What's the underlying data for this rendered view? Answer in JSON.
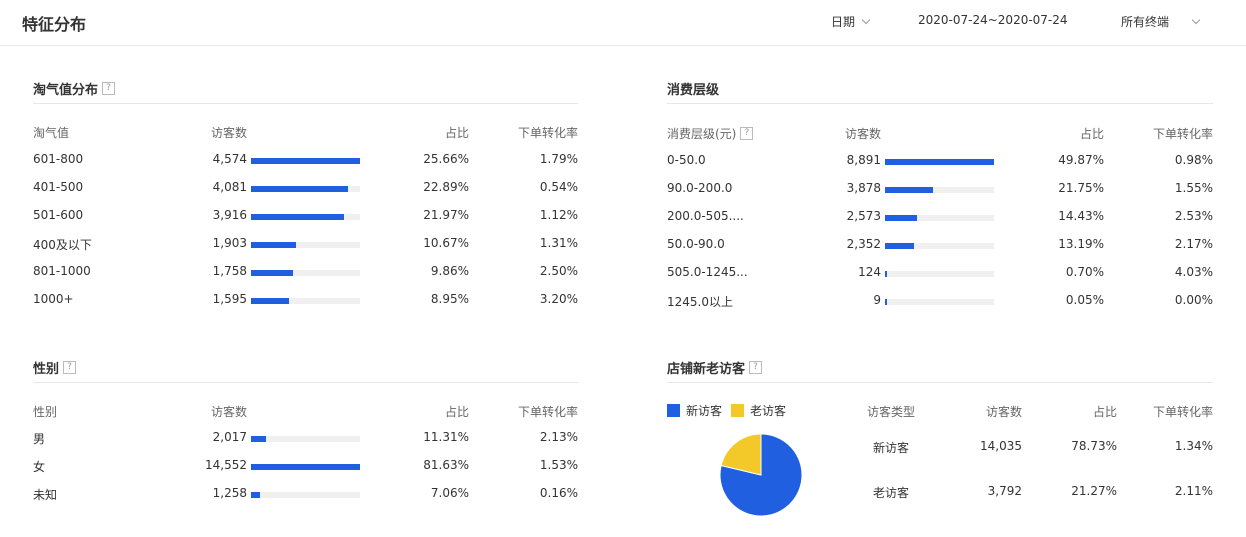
{
  "header": {
    "title": "特征分布",
    "date_label": "日期",
    "date_range": "2020-07-24~2020-07-24",
    "device": "所有终端"
  },
  "taoqi": {
    "title": "淘气值分布",
    "help": "?",
    "columns": [
      "淘气值",
      "访客数",
      "占比",
      "下单转化率"
    ],
    "rows": [
      {
        "label": "601-800",
        "visitors": "4,574",
        "share": "25.66%",
        "conv": "1.79%",
        "fill": 1.0
      },
      {
        "label": "401-500",
        "visitors": "4,081",
        "share": "22.89%",
        "conv": "0.54%",
        "fill": 0.892
      },
      {
        "label": "501-600",
        "visitors": "3,916",
        "share": "21.97%",
        "conv": "1.12%",
        "fill": 0.856
      },
      {
        "label": "400及以下",
        "visitors": "1,903",
        "share": "10.67%",
        "conv": "1.31%",
        "fill": 0.416
      },
      {
        "label": "801-1000",
        "visitors": "1,758",
        "share": "9.86%",
        "conv": "2.50%",
        "fill": 0.384
      },
      {
        "label": "1000+",
        "visitors": "1,595",
        "share": "8.95%",
        "conv": "3.20%",
        "fill": 0.349
      }
    ]
  },
  "spend": {
    "title": "消费层级",
    "columns": [
      "消费层级(元)",
      "访客数",
      "占比",
      "下单转化率"
    ],
    "help": "?",
    "rows": [
      {
        "label": "0-50.0",
        "visitors": "8,891",
        "share": "49.87%",
        "conv": "0.98%",
        "fill": 1.0
      },
      {
        "label": "90.0-200.0",
        "visitors": "3,878",
        "share": "21.75%",
        "conv": "1.55%",
        "fill": 0.436
      },
      {
        "label": "200.0-505....",
        "visitors": "2,573",
        "share": "14.43%",
        "conv": "2.53%",
        "fill": 0.289
      },
      {
        "label": "50.0-90.0",
        "visitors": "2,352",
        "share": "13.19%",
        "conv": "2.17%",
        "fill": 0.265
      },
      {
        "label": "505.0-1245...",
        "visitors": "124",
        "share": "0.70%",
        "conv": "4.03%",
        "fill": 0.014
      },
      {
        "label": "1245.0以上",
        "visitors": "9",
        "share": "0.05%",
        "conv": "0.00%",
        "fill": 0.001
      }
    ]
  },
  "gender": {
    "title": "性别",
    "help": "?",
    "columns": [
      "性别",
      "访客数",
      "占比",
      "下单转化率"
    ],
    "rows": [
      {
        "label": "男",
        "visitors": "2,017",
        "share": "11.31%",
        "conv": "2.13%",
        "fill": 0.139
      },
      {
        "label": "女",
        "visitors": "14,552",
        "share": "81.63%",
        "conv": "1.53%",
        "fill": 1.0
      },
      {
        "label": "未知",
        "visitors": "1,258",
        "share": "7.06%",
        "conv": "0.16%",
        "fill": 0.086
      }
    ]
  },
  "newold": {
    "title": "店铺新老访客",
    "help": "?",
    "legend": [
      {
        "label": "新访客",
        "color": "#1f5fe0"
      },
      {
        "label": "老访客",
        "color": "#f2c928"
      }
    ],
    "columns": [
      "访客类型",
      "访客数",
      "占比",
      "下单转化率"
    ],
    "rows": [
      {
        "label": "新访客",
        "visitors": "14,035",
        "share": "78.73%",
        "conv": "1.34%"
      },
      {
        "label": "老访客",
        "visitors": "3,792",
        "share": "21.27%",
        "conv": "2.11%"
      }
    ]
  },
  "chart_data": {
    "type": "pie",
    "categories": [
      "新访客",
      "老访客"
    ],
    "values": [
      78.73,
      21.27
    ],
    "colors": [
      "#1f5fe0",
      "#f2c928"
    ]
  },
  "colors": {
    "accent": "#1f5fe0",
    "secondary": "#f2c928",
    "track": "#f0f0f0"
  }
}
